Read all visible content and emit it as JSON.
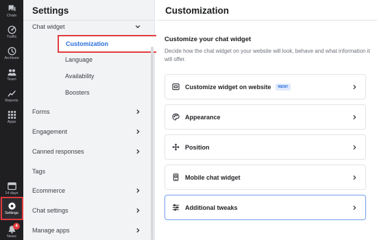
{
  "rail": {
    "items": [
      {
        "label": "Chats",
        "icon": "chat-icon"
      },
      {
        "label": "Traffic",
        "icon": "traffic-icon"
      },
      {
        "label": "Archives",
        "icon": "archive-icon"
      },
      {
        "label": "Team",
        "icon": "team-icon"
      },
      {
        "label": "Reports",
        "icon": "reports-icon"
      },
      {
        "label": "Apps",
        "icon": "apps-icon"
      },
      {
        "label": "14 days",
        "icon": "trial-icon"
      },
      {
        "label": "Settings",
        "icon": "gear-icon"
      },
      {
        "label": "News",
        "icon": "bell-icon",
        "badge": "4"
      }
    ]
  },
  "sidebar": {
    "title": "Settings",
    "group": "Chat widget",
    "sub_items": [
      "Customization",
      "Language",
      "Availability",
      "Boosters"
    ],
    "items": [
      {
        "label": "Forms",
        "chevron": true
      },
      {
        "label": "Engagement",
        "chevron": true
      },
      {
        "label": "Canned responses",
        "chevron": true
      },
      {
        "label": "Tags",
        "chevron": false
      },
      {
        "label": "Ecommerce",
        "chevron": true
      },
      {
        "label": "Chat settings",
        "chevron": true
      },
      {
        "label": "Manage apps",
        "chevron": true
      }
    ]
  },
  "main": {
    "title": "Customization",
    "section_title": "Customize your chat widget",
    "section_desc": "Decide how the chat widget on your website will look, behave and what information it will offer.",
    "cards": [
      {
        "label": "Customize widget on website",
        "badge": "NEW!",
        "icon": "widget-icon"
      },
      {
        "label": "Appearance",
        "icon": "palette-icon"
      },
      {
        "label": "Position",
        "icon": "move-icon"
      },
      {
        "label": "Mobile chat widget",
        "icon": "mobile-icon"
      },
      {
        "label": "Additional tweaks",
        "icon": "sliders-icon"
      }
    ]
  },
  "colors": {
    "accent": "#2a6fdb",
    "highlight": "#e03a3e",
    "rail": "#1f1f22"
  }
}
